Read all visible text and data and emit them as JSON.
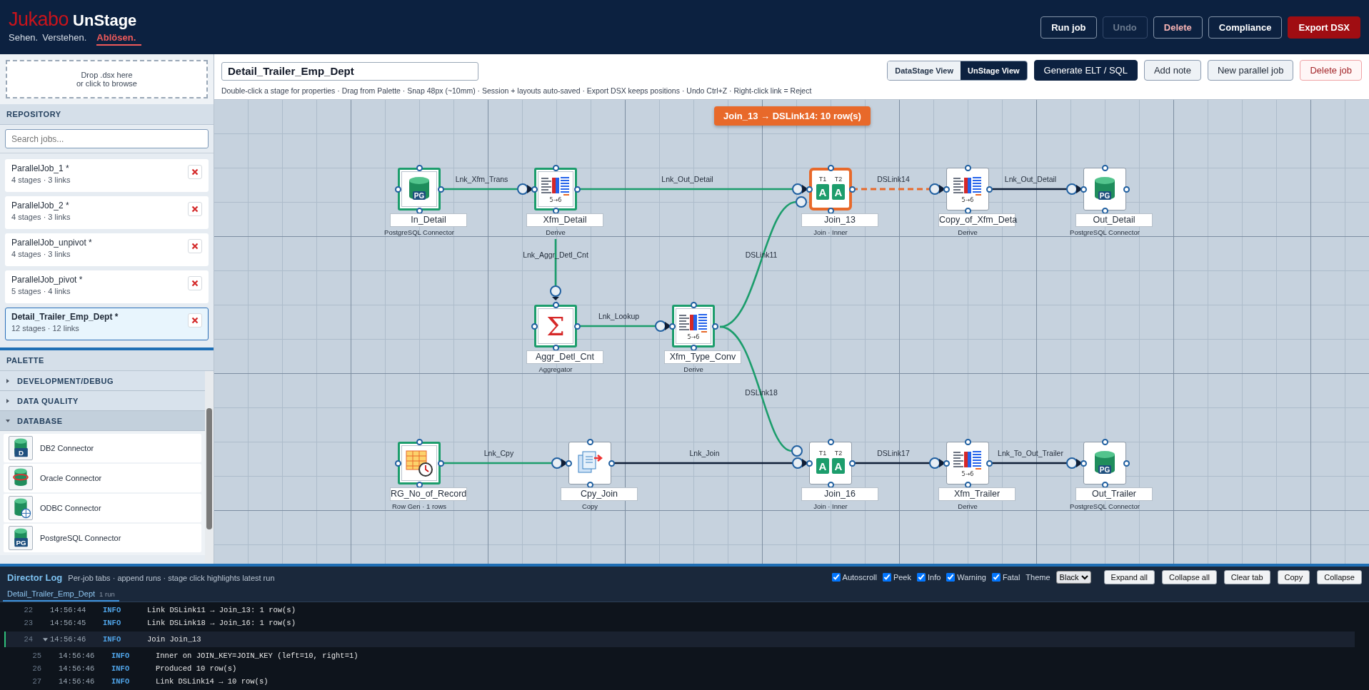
{
  "header": {
    "logo": {
      "brand": "Jukabo",
      "product": "UnStage"
    },
    "tagline": [
      {
        "text": "Sehen.",
        "emphasis": false
      },
      {
        "text": "Verstehen.",
        "emphasis": false
      },
      {
        "text": "Ablösen.",
        "emphasis": true
      }
    ],
    "buttons": [
      {
        "label": "Run job",
        "kind": "outline",
        "disabled": false
      },
      {
        "label": "Undo",
        "kind": "outline",
        "disabled": true
      },
      {
        "label": "Delete",
        "kind": "danger",
        "disabled": false
      },
      {
        "label": "Compliance",
        "kind": "outline",
        "disabled": false
      },
      {
        "label": "Export DSX",
        "kind": "primary",
        "disabled": false
      }
    ]
  },
  "sidebar": {
    "dropzone": [
      "Drop .dsx here",
      "or click to browse"
    ],
    "repository": {
      "title": "REPOSITORY",
      "search": {
        "placeholder": "Search jobs..."
      },
      "jobs": [
        {
          "name": "ParallelJob_1 *",
          "meta": "4 stages · 3 links",
          "selected": false
        },
        {
          "name": "ParallelJob_2 *",
          "meta": "4 stages · 3 links",
          "selected": false
        },
        {
          "name": "ParallelJob_unpivot *",
          "meta": "4 stages · 3 links",
          "selected": false
        },
        {
          "name": "ParallelJob_pivot *",
          "meta": "5 stages · 4 links",
          "selected": false
        },
        {
          "name": "Detail_Trailer_Emp_Dept *",
          "meta": "12 stages · 12 links",
          "selected": true
        }
      ]
    },
    "palette": {
      "title": "PALETTE",
      "groups": [
        {
          "label": "DEVELOPMENT/DEBUG",
          "expanded": false
        },
        {
          "label": "DATA QUALITY",
          "expanded": false
        },
        {
          "label": "DATABASE",
          "expanded": true,
          "items": [
            {
              "label": "DB2 Connector",
              "kind": "db2",
              "badge": "D"
            },
            {
              "label": "Oracle Connector",
              "kind": "oracle"
            },
            {
              "label": "ODBC Connector",
              "kind": "odbc"
            },
            {
              "label": "PostgreSQL Connector",
              "kind": "pg",
              "badge": "PG"
            }
          ]
        }
      ]
    }
  },
  "toolbar": {
    "job_name": {
      "value": "Detail_Trailer_Emp_Dept"
    },
    "hint": "Double-click a stage for properties · Drag from Palette · Snap 48px (~10mm) · Session + layouts auto-saved · Export DSX keeps positions · Undo Ctrl+Z · Right-click link = Reject",
    "views": [
      {
        "label": "DataStage View",
        "selected": false
      },
      {
        "label": "UnStage View",
        "selected": true
      }
    ],
    "buttons": [
      {
        "label": "Generate ELT / SQL",
        "kind": "primary"
      },
      {
        "label": "Add note",
        "kind": "default"
      },
      {
        "label": "New parallel job",
        "kind": "default"
      },
      {
        "label": "Delete job",
        "kind": "danger"
      }
    ]
  },
  "canvas": {
    "toast": "Join_13 → DSLink14: 10 row(s)",
    "stages": [
      {
        "name": "In_Detail",
        "type": "PostgreSQL Connector",
        "kind": "pg",
        "badge": "PG",
        "ran": true,
        "selected": false
      },
      {
        "name": "Xfm_Detail",
        "type": "Derive",
        "kind": "transformer",
        "badge": "5→6",
        "ran": true,
        "selected": false
      },
      {
        "name": "Join_13",
        "type": "Join · Inner",
        "kind": "join",
        "tags": [
          {
            "label": "T1",
            "glyph": "A"
          },
          {
            "label": "T2",
            "glyph": "A"
          }
        ],
        "ran": false,
        "selected": true
      },
      {
        "name": "Copy_of_Xfm_Deta",
        "type": "Derive",
        "kind": "transformer",
        "badge": "5→6",
        "ran": false,
        "selected": false
      },
      {
        "name": "Out_Detail",
        "type": "PostgreSQL Connector",
        "kind": "pg",
        "badge": "PG",
        "ran": false,
        "selected": false
      },
      {
        "name": "Aggr_Detl_Cnt",
        "type": "Aggregator",
        "kind": "aggregator",
        "badge": "Σ",
        "ran": true,
        "selected": false
      },
      {
        "name": "Xfm_Type_Conv",
        "type": "Derive",
        "kind": "transformer",
        "badge": "5→6",
        "ran": true,
        "selected": false
      },
      {
        "name": "RG_No_of_Record",
        "type": "Row Gen · 1 rows",
        "kind": "rowgen",
        "ran": true,
        "selected": false
      },
      {
        "name": "Cpy_Join",
        "type": "Copy",
        "kind": "copy",
        "ran": false,
        "selected": false
      },
      {
        "name": "Join_16",
        "type": "Join · Inner",
        "kind": "join",
        "tags": [
          {
            "label": "T1",
            "glyph": "A"
          },
          {
            "label": "T2",
            "glyph": "A"
          }
        ],
        "ran": false,
        "selected": false
      },
      {
        "name": "Xfm_Trailer",
        "type": "Derive",
        "kind": "transformer",
        "badge": "5→6",
        "ran": false,
        "selected": false
      },
      {
        "name": "Out_Trailer",
        "type": "PostgreSQL Connector",
        "kind": "pg",
        "badge": "PG",
        "ran": false,
        "selected": false
      }
    ],
    "links": [
      {
        "label": "Lnk_Xfm_Trans",
        "ran": true,
        "selected": false
      },
      {
        "label": "Lnk_Out_Detail",
        "ran": true,
        "selected": false
      },
      {
        "label": "Lnk_Aggr_Detl_Cnt",
        "ran": true,
        "selected": false
      },
      {
        "label": "Lnk_Lookup",
        "ran": true,
        "selected": false
      },
      {
        "label": "DSLink11",
        "ran": true,
        "selected": false
      },
      {
        "label": "DSLink18",
        "ran": true,
        "selected": false
      },
      {
        "label": "Lnk_Cpy",
        "ran": true,
        "selected": false
      },
      {
        "label": "Lnk_Join",
        "ran": false,
        "selected": false
      },
      {
        "label": "DSLink14",
        "ran": false,
        "selected": true
      },
      {
        "label": "Lnk_Out_Detail",
        "ran": false,
        "selected": false
      },
      {
        "label": "DSLink17",
        "ran": false,
        "selected": false
      },
      {
        "label": "Lnk_To_Out_Trailer",
        "ran": false,
        "selected": false
      }
    ]
  },
  "director_log": {
    "title": "Director Log",
    "subtitle": "Per-job tabs · append runs · stage click highlights latest run",
    "filters": [
      {
        "label": "Autoscroll",
        "checked": true
      },
      {
        "label": "Peek",
        "checked": true
      },
      {
        "label": "Info",
        "checked": true
      },
      {
        "label": "Warning",
        "checked": true
      },
      {
        "label": "Fatal",
        "checked": true
      }
    ],
    "theme": {
      "label": "Theme",
      "value": "Black"
    },
    "buttons": [
      "Expand all",
      "Collapse all",
      "Clear tab",
      "Copy",
      "Collapse"
    ],
    "tabs": [
      {
        "label": "Detail_Trailer_Emp_Dept",
        "count": "1 run",
        "selected": true
      }
    ],
    "rows": [
      {
        "kind": "entry",
        "line": "22",
        "time": "14:56:44",
        "level": "INFO",
        "message": "Link DSLink11 → Join_13: 1 row(s)",
        "highlighted": false
      },
      {
        "kind": "entry",
        "line": "23",
        "time": "14:56:45",
        "level": "INFO",
        "message": "Link DSLink18 → Join_16: 1 row(s)",
        "highlighted": false
      },
      {
        "kind": "group",
        "line": "24",
        "time": "14:56:46",
        "level": "INFO",
        "message": "Join Join_13",
        "highlighted": true,
        "expanded": true,
        "children": [
          {
            "line": "25",
            "time": "14:56:46",
            "level": "INFO",
            "message": "Inner on JOIN_KEY=JOIN_KEY (left=10, right=1)"
          },
          {
            "line": "26",
            "time": "14:56:46",
            "level": "INFO",
            "message": "Produced 10 row(s)"
          },
          {
            "line": "27",
            "time": "14:56:46",
            "level": "INFO",
            "message": "Link DSLink14 → 10 row(s)"
          }
        ]
      }
    ]
  }
}
